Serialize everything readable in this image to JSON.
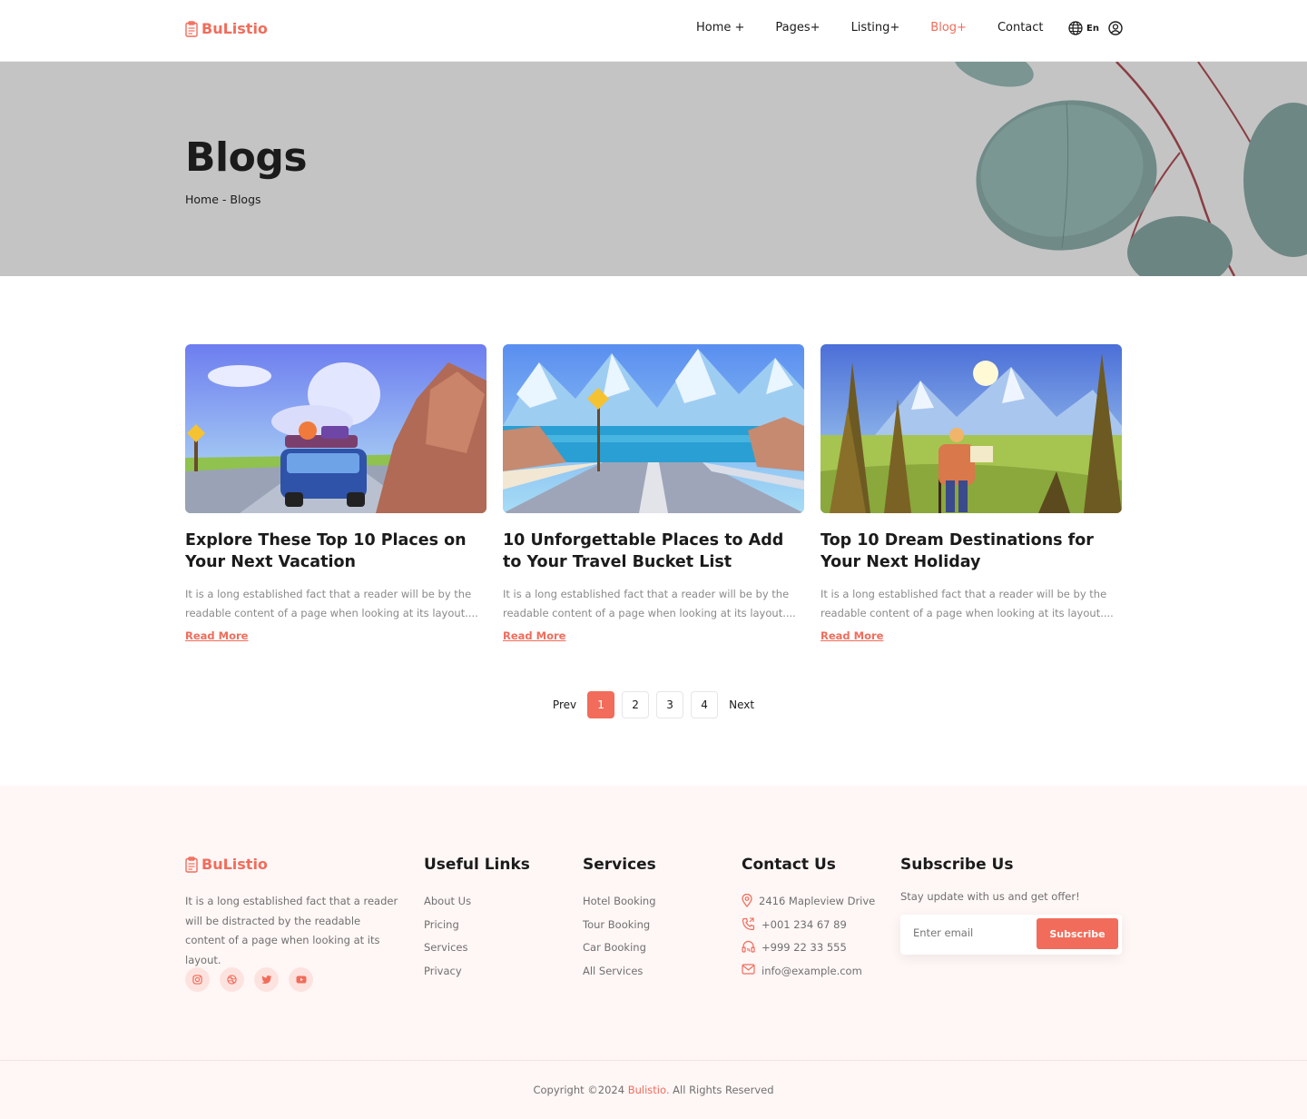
{
  "header": {
    "logo": "BuListio",
    "nav": [
      {
        "label": "Home +",
        "active": false
      },
      {
        "label": "Pages+",
        "active": false
      },
      {
        "label": "Listing+",
        "active": false
      },
      {
        "label": "Blog+",
        "active": true
      },
      {
        "label": "Contact",
        "active": false
      }
    ],
    "lang": "En"
  },
  "hero": {
    "title": "Blogs",
    "breadcrumb": "Home - Blogs"
  },
  "posts": [
    {
      "title": "Explore These Top 10 Places on Your Next Vacation",
      "excerpt": "It is a long established fact that a reader will be by the readable content of a page when looking at its layout....",
      "link": "Read More"
    },
    {
      "title": "10 Unforgettable Places to Add to Your Travel Bucket List",
      "excerpt": "It is a long established fact that a reader will be by the readable content of a page when looking at its layout....",
      "link": "Read More"
    },
    {
      "title": "Top 10 Dream Destinations for Your Next Holiday",
      "excerpt": "It is a long established fact that a reader will be by the readable content of a page when looking at its layout....",
      "link": "Read More"
    }
  ],
  "pagination": {
    "prev": "Prev",
    "pages": [
      "1",
      "2",
      "3",
      "4"
    ],
    "current": "1",
    "next": "Next"
  },
  "footer": {
    "logo": "BuListio",
    "about": "It is a long established fact that a reader will be distracted by the readable content of a page when looking at its layout.",
    "socials": [
      "instagram-icon",
      "dribbble-icon",
      "twitter-icon",
      "youtube-icon"
    ],
    "useful_links": {
      "title": "Useful Links",
      "items": [
        "About Us",
        "Pricing",
        "Services",
        "Privacy"
      ]
    },
    "services": {
      "title": "Services",
      "items": [
        "Hotel Booking",
        "Tour Booking",
        "Car Booking",
        "All Services"
      ]
    },
    "contact": {
      "title": "Contact Us",
      "address": "2416 Mapleview Drive",
      "phone1": "+001 234 67 89",
      "phone2": "+999 22 33 555",
      "email": "info@example.com"
    },
    "subscribe": {
      "title": "Subscribe Us",
      "text": "Stay update with us and get offer!",
      "placeholder": "Enter email",
      "button": "Subscribe"
    },
    "copyright_prefix": "Copyright ©2024 ",
    "copyright_brand": "Bulistio.",
    "copyright_suffix": " All Rights Reserved"
  },
  "colors": {
    "accent": "#f26c5b",
    "hero_bg": "#c4c4c4",
    "footer_bg": "#fff7f6"
  }
}
